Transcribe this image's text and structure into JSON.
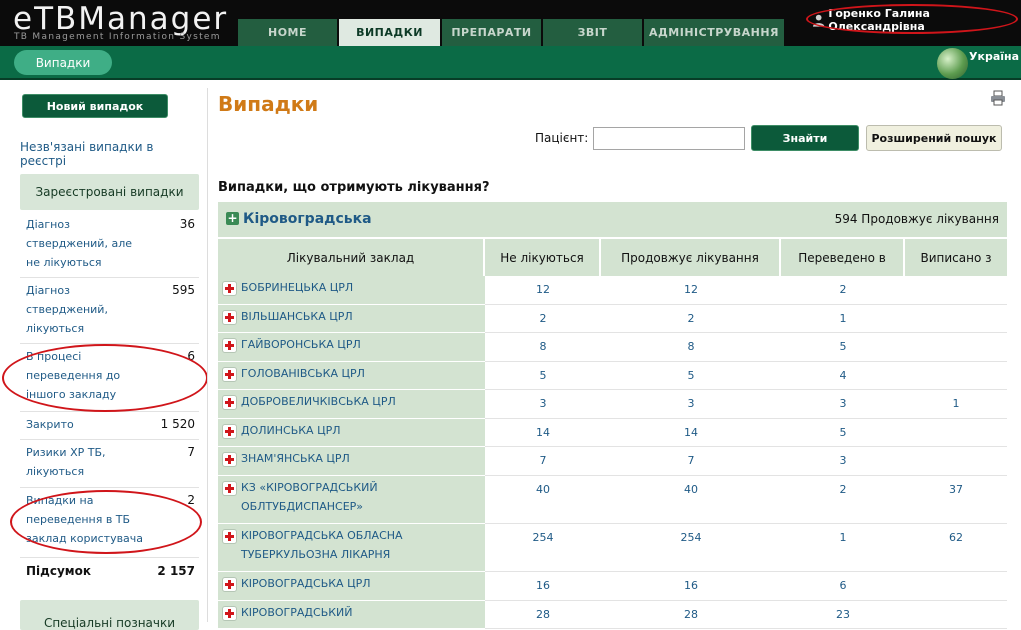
{
  "header": {
    "logo": "eTBManager",
    "logo_subtitle": "TB Management Information System",
    "tabs": [
      "HOME",
      "ВИПАДКИ",
      "ПРЕПАРАТИ",
      "ЗВІТ",
      "АДМІНІСТРУВАННЯ"
    ],
    "active_tab": "ВИПАДКИ",
    "user_name": "Горенко Галина Олександрівна"
  },
  "subheader": {
    "breadcrumb": "Випадки",
    "country": "Україна"
  },
  "sidebar": {
    "new_case_label": "Новий випадок",
    "unlinked_label": "Незв'язані випадки в реєстрі",
    "registered_title": "Зареєстровані випадки",
    "items": [
      {
        "label": "Діагноз стверджений, але не лікуються",
        "count": "36"
      },
      {
        "label": "Діагноз стверджений, лікуються",
        "count": "595"
      },
      {
        "label": "В процесі переведення до іншого закладу",
        "count": "6"
      },
      {
        "label": "Закрито",
        "count": "1 520"
      },
      {
        "label": "Ризики ХР ТБ, лікуються",
        "count": "7"
      },
      {
        "label": "Випадки на переведення в ТБ заклад користувача",
        "count": "2"
      }
    ],
    "total_label": "Підсумок",
    "total_count": "2 157",
    "special_title": "Спеціальні позначки"
  },
  "main": {
    "title": "Випадки",
    "patient_label": "Пацієнт:",
    "patient_value": "",
    "find_label": "Знайти",
    "advanced_label": "Розширений пошук",
    "question": "Випадки, що отримують лікування?",
    "region_name": "Кіровоградська",
    "region_summary": "594 Продовжує лікування",
    "columns": [
      "Лікувальний заклад",
      "Не лікуються",
      "Продовжує лікування",
      "Переведено в",
      "Виписано з"
    ],
    "rows": [
      {
        "name": "БОБРИНЕЦЬКА ЦРЛ",
        "not_treated": "12",
        "continues": "12",
        "transferred_in": "2",
        "transferred_out": ""
      },
      {
        "name": "ВІЛЬШАНСЬКА ЦРЛ",
        "not_treated": "2",
        "continues": "2",
        "transferred_in": "1",
        "transferred_out": ""
      },
      {
        "name": "ГАЙВОРОНСЬКА ЦРЛ",
        "not_treated": "8",
        "continues": "8",
        "transferred_in": "5",
        "transferred_out": ""
      },
      {
        "name": "ГОЛОВАНІВСЬКА ЦРЛ",
        "not_treated": "5",
        "continues": "5",
        "transferred_in": "4",
        "transferred_out": ""
      },
      {
        "name": "ДОБРОВЕЛИЧКІВСЬКА ЦРЛ",
        "not_treated": "3",
        "continues": "3",
        "transferred_in": "3",
        "transferred_out": "1"
      },
      {
        "name": "ДОЛИНСЬКА ЦРЛ",
        "not_treated": "14",
        "continues": "14",
        "transferred_in": "5",
        "transferred_out": ""
      },
      {
        "name": "ЗНАМ'ЯНСЬКА ЦРЛ",
        "not_treated": "7",
        "continues": "7",
        "transferred_in": "3",
        "transferred_out": ""
      },
      {
        "name": "КЗ «КІРОВОГРАДСЬКИЙ ОБЛТУБДИСПАНСЕР»",
        "not_treated": "40",
        "continues": "40",
        "transferred_in": "2",
        "transferred_out": "37"
      },
      {
        "name": "КІРОВОГРАДСЬКА ОБЛАСНА ТУБЕРКУЛЬОЗНА ЛІКАРНЯ",
        "not_treated": "254",
        "continues": "254",
        "transferred_in": "1",
        "transferred_out": "62"
      },
      {
        "name": "КІРОВОГРАДСЬКА ЦРЛ",
        "not_treated": "16",
        "continues": "16",
        "transferred_in": "6",
        "transferred_out": ""
      },
      {
        "name": "КІРОВОГРАДСЬКИЙ",
        "not_treated": "28",
        "continues": "28",
        "transferred_in": "23",
        "transferred_out": ""
      }
    ]
  },
  "colors": {
    "header_bg": "#0b0b0b",
    "tab_bg": "#235e40",
    "tab_active_bg": "#dfe9e1",
    "subbar_bg": "#0b6b46",
    "breadcrumb_bg": "#3fae86",
    "title_orange": "#d07a17",
    "link_blue": "#1f5a86",
    "table_green": "#d3e3d1",
    "annotation_red": "#d0151a"
  },
  "icons": [
    "user-icon",
    "globe-icon",
    "printer-icon",
    "expand-plus-icon",
    "hospital-icon"
  ]
}
